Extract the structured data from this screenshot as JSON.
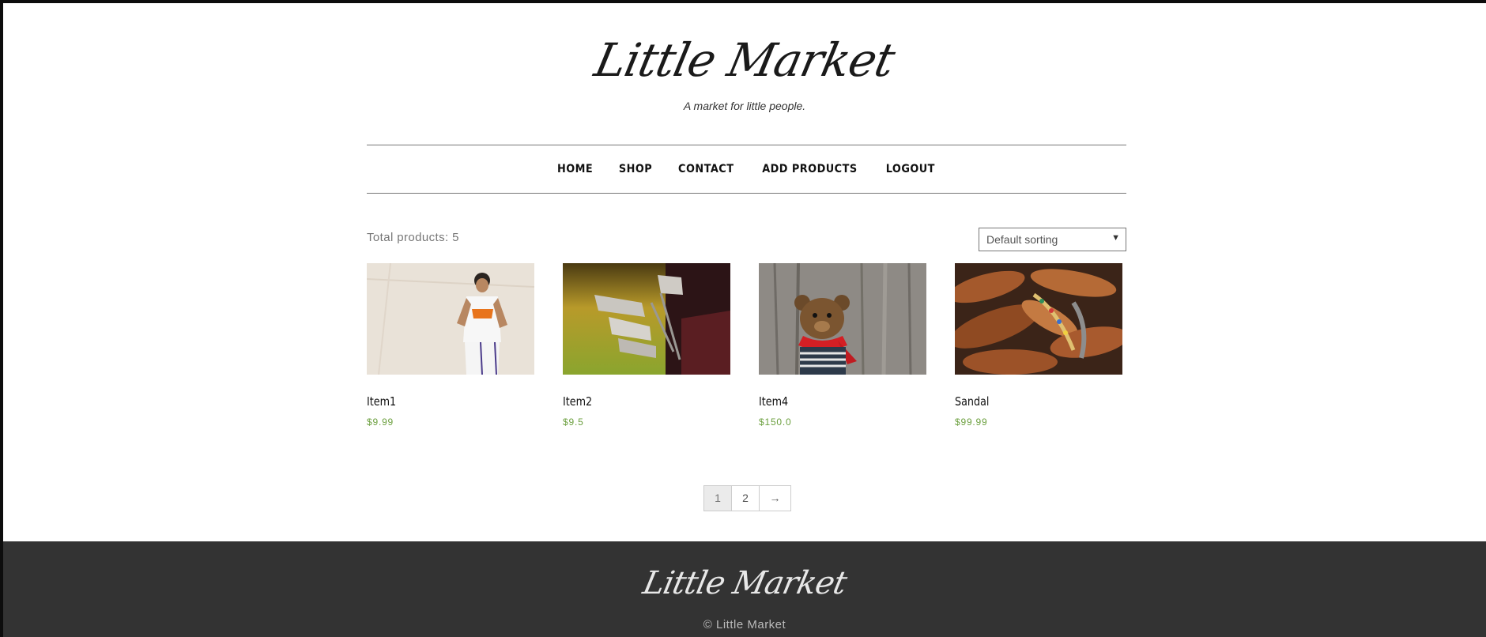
{
  "header": {
    "site_title": "Little Market",
    "tagline": "A market for little people."
  },
  "nav": {
    "items": [
      "HOME",
      "SHOP",
      "CONTACT",
      "ADD PRODUCTS",
      "LOGOUT"
    ]
  },
  "toolbar": {
    "total_products": "Total products: 5",
    "sort_selected": "Default sorting"
  },
  "products": [
    {
      "name": "Item1",
      "price": "$9.99",
      "image": "basketball-player-photo"
    },
    {
      "name": "Item2",
      "price": "$9.5",
      "image": "golf-clubs-photo"
    },
    {
      "name": "Item4",
      "price": "$150.0",
      "image": "teddy-bear-photo"
    },
    {
      "name": "Sandal",
      "price": "$99.99",
      "image": "sandals-photo"
    }
  ],
  "pagination": {
    "pages": [
      "1",
      "2"
    ],
    "current": "1",
    "next": "→"
  },
  "footer": {
    "logo": "Little Market",
    "copyright": "© Little Market"
  },
  "colors": {
    "price": "#6b9f3e",
    "footer_bg": "#333333",
    "outer_frame": "#0d0d0d"
  }
}
